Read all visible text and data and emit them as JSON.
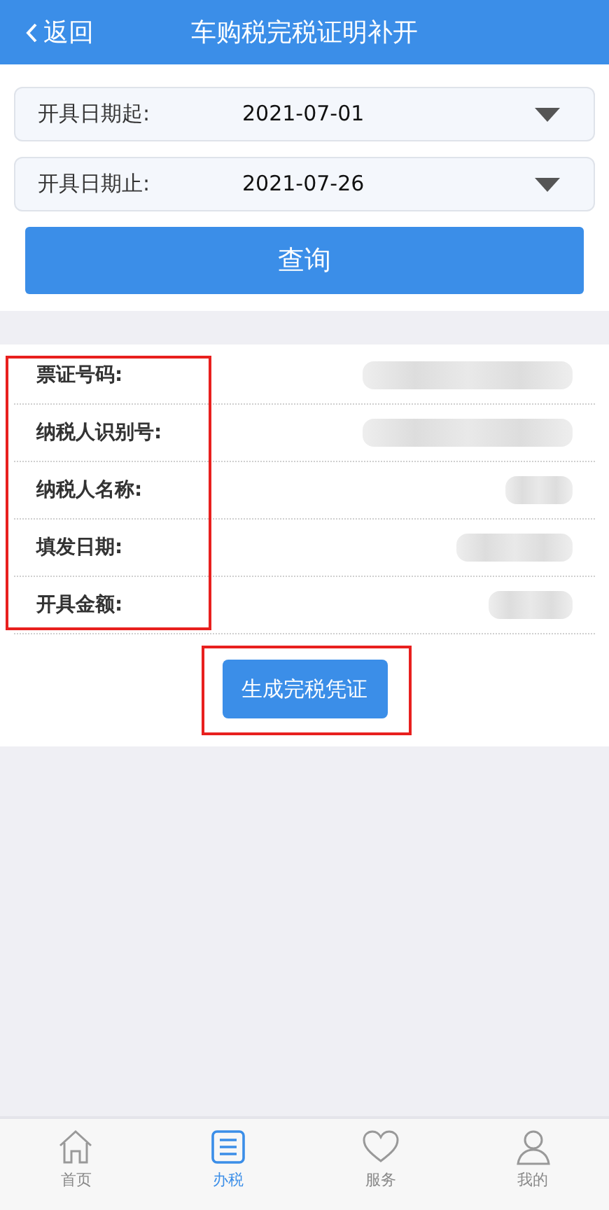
{
  "header": {
    "back": "返回",
    "title": "车购税完税证明补开"
  },
  "filters": [
    {
      "label": "开具日期起:",
      "value": "2021-07-01"
    },
    {
      "label": "开具日期止:",
      "value": "2021-07-26"
    }
  ],
  "query_button": "查询",
  "details": [
    {
      "label": "票证号码:",
      "value_redacted": true
    },
    {
      "label": "纳税人识别号:",
      "value_redacted": true
    },
    {
      "label": "纳税人名称:",
      "value_redacted": true
    },
    {
      "label": "填发日期:",
      "value_redacted": true
    },
    {
      "label": "开具金额:",
      "value_redacted": true
    }
  ],
  "details_highlighted": true,
  "generate_button": "生成完税凭证",
  "generate_highlighted": true,
  "tab_bar": [
    {
      "label": "首页",
      "selected": false
    },
    {
      "label": "办税",
      "selected": true
    },
    {
      "label": "服务",
      "selected": false
    },
    {
      "label": "我的",
      "selected": false
    }
  ]
}
